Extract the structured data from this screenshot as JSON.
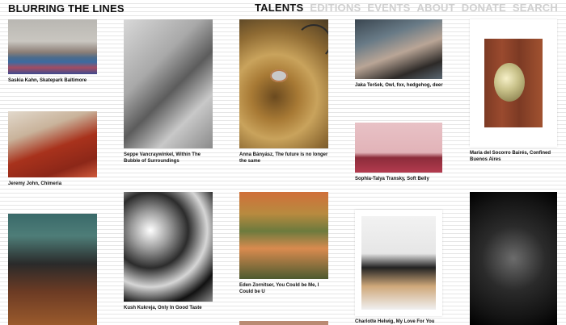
{
  "site": {
    "title": "BLURRING THE LINES"
  },
  "nav": {
    "items": [
      {
        "label": "TALENTS",
        "active": true
      },
      {
        "label": "EDITIONS",
        "active": false
      },
      {
        "label": "EVENTS",
        "active": false
      },
      {
        "label": "ABOUT",
        "active": false
      },
      {
        "label": "DONATE",
        "active": false
      },
      {
        "label": "SEARCH",
        "active": false
      }
    ]
  },
  "works": [
    {
      "caption": "Saskia Kahn, Skatepark Baltimore"
    },
    {
      "caption": "Seppe Vancraywinkel, Within The Bubble of Surroundings"
    },
    {
      "caption": "Anna Bányász, The future is no longer the same"
    },
    {
      "caption": "Jaka Teršek, Owl, fox, hedgehog, deer"
    },
    {
      "caption": "Maria del Socorro Bairés, Confined Buenos Aires"
    },
    {
      "caption": "Jeremy John, Chimeria"
    },
    {
      "caption": "Sophia-Talya Transky, Soft Belly"
    },
    {
      "caption": "Kush Kukreja, Only In Good Taste"
    },
    {
      "caption": "Eden Zornitser, You Could be Me, I Could be U"
    },
    {
      "caption": "Charlotte Helwig, My Love For You"
    }
  ],
  "colors": {
    "active_nav": "#111111",
    "inactive_nav": "#cfcfcf",
    "background_stripe": "#e6e6e6"
  }
}
